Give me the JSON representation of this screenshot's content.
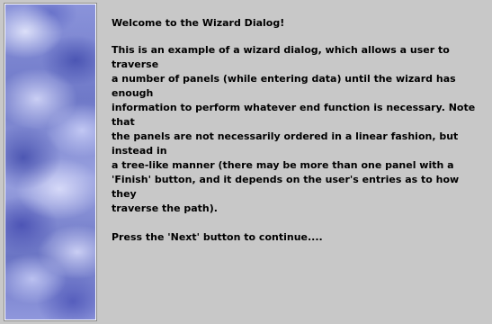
{
  "wizard": {
    "title": "Welcome to the Wizard Dialog!",
    "description": "This is an example of a wizard dialog, which allows a user to traverse\na number of panels (while entering data) until the wizard has enough\ninformation to perform whatever end function is necessary. Note that\nthe panels are not necessarily ordered in a linear fashion, but instead in\na tree-like manner (there may be more than one panel with a\n'Finish' button, and it depends on the user's entries as to how they\ntraverse the path).",
    "prompt": "Press the 'Next' button to continue...."
  },
  "colors": {
    "background": "#c8c8c8",
    "side_image_tint": "#7e88d4",
    "text": "#000000"
  }
}
